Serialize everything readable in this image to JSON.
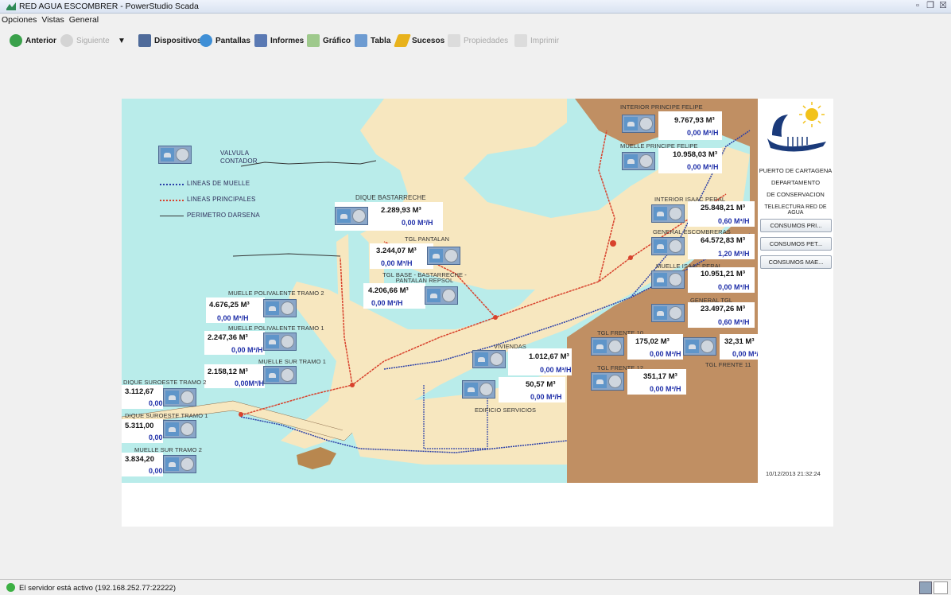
{
  "window": {
    "title": "RED AGUA ESCOMBRER - PowerStudio Scada"
  },
  "menu": [
    "Opciones",
    "Vistas",
    "General"
  ],
  "toolbar": {
    "anterior": "Anterior",
    "siguiente": "Siguiente",
    "dispositivos": "Dispositivos",
    "pantallas": "Pantallas",
    "informes": "Informes",
    "grafico": "Gráfico",
    "tabla": "Tabla",
    "sucesos": "Sucesos",
    "propiedades": "Propiedades",
    "imprimir": "Imprimir"
  },
  "legend": {
    "valvula": "VALVULA",
    "contador": "CONTADOR",
    "lineas_muelle": "LINEAS DE MUELLE",
    "lineas_principales": "LINEAS PRINCIPALES",
    "perimetro": "PERIMETRO DARSENA"
  },
  "meters": {
    "interior_principe": {
      "label": "INTERIOR PRINCIPE FELIPE",
      "volume": "9.767,93  M³",
      "flow": "0,00  M³/H"
    },
    "muelle_principe": {
      "label": "MUELLE PRINCIPE FELIPE",
      "volume": "10.958,03  M³",
      "flow": "0,00  M³/H"
    },
    "dique_bastarreche": {
      "label": "DIQUE BASTARRECHE",
      "volume": "2.289,93  M³",
      "flow": "0,00  M³/H"
    },
    "interior_isaac": {
      "label": "INTERIOR ISAAC PERAL",
      "volume": "25.848,21  M³",
      "flow": "0,60  M³/H"
    },
    "general_escombreras": {
      "label": "GENERAL ESCOMBRERAS",
      "volume": "64.572,83  M³",
      "flow": "1,20  M³/H"
    },
    "muelle_isaac": {
      "label": "MUELLE ISAAC PERAL",
      "volume": "10.951,21  M³",
      "flow": "0,00  M³/H"
    },
    "general_tgl": {
      "label": "GENERAL TGL",
      "volume": "23.497,26  M³",
      "flow": "0,60  M³/H"
    },
    "tgl_pantalan": {
      "label": "TGL PANTALAN",
      "volume": "3.244,07  M³",
      "flow": "0,00  M³/H"
    },
    "tgl_base": {
      "label": "TGL BASE - BASTARRECHE - PANTALAN REPSOL",
      "volume": "4.206,66  M³",
      "flow": "0,00  M³/H"
    },
    "muelle_poli_2": {
      "label": "MUELLE POLIVALENTE TRAMO 2",
      "volume": "4.676,25  M³",
      "flow": "0,00  M³/H"
    },
    "muelle_poli_1": {
      "label": "MUELLE POLIVALENTE TRAMO 1",
      "volume": "2.247,36  M³",
      "flow": "0,00  M³/H"
    },
    "muelle_sur_1": {
      "label": "MUELLE SUR TRAMO 1",
      "volume": "2.158,12  M³",
      "flow": "0,00M³/H"
    },
    "dique_so_2": {
      "label": "DIQUE SUROESTE TRAMO 2",
      "volume": "3.112,67",
      "flow": "0,00"
    },
    "dique_so_1": {
      "label": "DIQUE SUROESTE TRAMO 1",
      "volume": "5.311,00",
      "flow": "0,00"
    },
    "muelle_sur_2": {
      "label": "MUELLE SUR TRAMO 2",
      "volume": "3.834,20",
      "flow": "0,00"
    },
    "viviendas": {
      "label": "VIVIENDAS",
      "volume": "1.012,67  M³",
      "flow": "0,00  M³/H"
    },
    "edificio": {
      "label": "EDIFICIO SERVICIOS",
      "volume": "50,57  M³",
      "flow": "0,00  M³/H"
    },
    "tgl_frente10": {
      "label": "TGL FRENTE 10",
      "volume": "175,02  M³",
      "flow": "0,00  M³/H"
    },
    "tgl_frente11": {
      "label": "TGL FRENTE 11",
      "volume": "32,31  M³",
      "flow": "0,00  M³/H"
    },
    "tgl_frente12": {
      "label": "TGL FRENTE 12",
      "volume": "351,17  M³",
      "flow": "0,00  M³/H"
    }
  },
  "side": {
    "line1": "PUERTO DE CARTAGENA",
    "line2": "DEPARTAMENTO",
    "line3": "DE CONSERVACION",
    "line4": "TELELECTURA RED DE AGUA",
    "btn1": "CONSUMOS PRI...",
    "btn2": "CONSUMOS PET...",
    "btn3": "CONSUMOS MAE...",
    "timestamp": "10/12/2013 21:32:24"
  },
  "status": {
    "text": "El servidor está activo (192.168.252.77:22222)"
  }
}
